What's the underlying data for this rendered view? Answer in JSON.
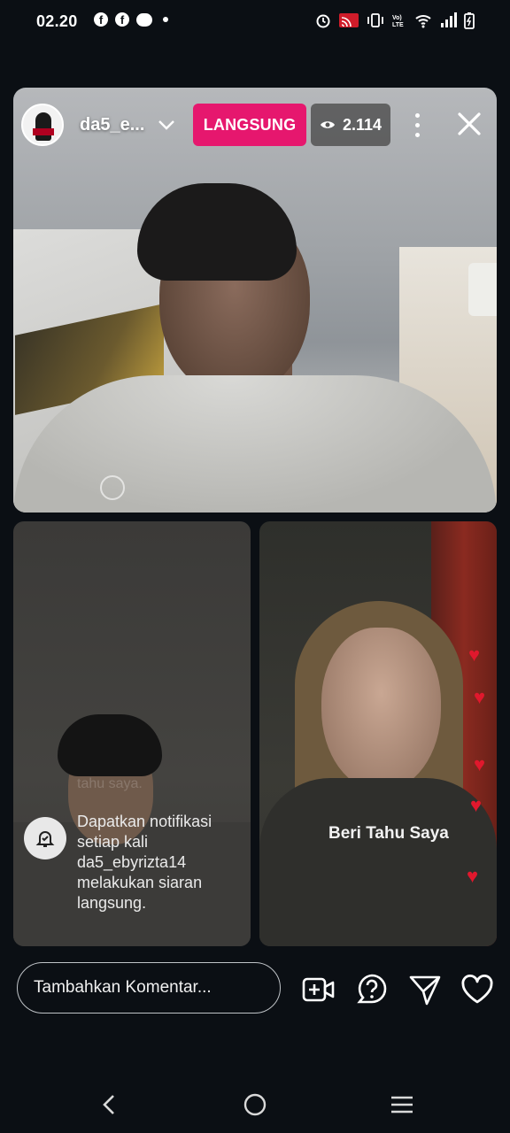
{
  "status_bar": {
    "time": "02.20",
    "left_icons": [
      "facebook-icon",
      "facebook-icon",
      "messenger-icon",
      "dot-icon"
    ],
    "right_icons": [
      "alarm-icon",
      "cast-icon",
      "vibrate-icon",
      "volte-icon",
      "wifi-icon",
      "signal-icon",
      "battery-charging-icon"
    ],
    "volte_label": "LTE"
  },
  "live": {
    "username": "da5_e...",
    "badge_label": "LANGSUNG",
    "viewer_count": "2.114",
    "badge_color": "#e6176e"
  },
  "guest_left": {
    "faint_text": "tahu saya.",
    "notification_text": "Dapatkan notifikasi setiap kali da5_ebyrizta14 melakukan siaran langsung."
  },
  "guest_right": {
    "notify_button_label": "Beri Tahu Saya"
  },
  "comment_bar": {
    "placeholder": "Tambahkan Komentar..."
  },
  "actions": [
    "add-video-icon",
    "question-icon",
    "send-icon",
    "heart-icon"
  ],
  "nav": [
    "back-icon",
    "home-icon",
    "recents-icon"
  ]
}
